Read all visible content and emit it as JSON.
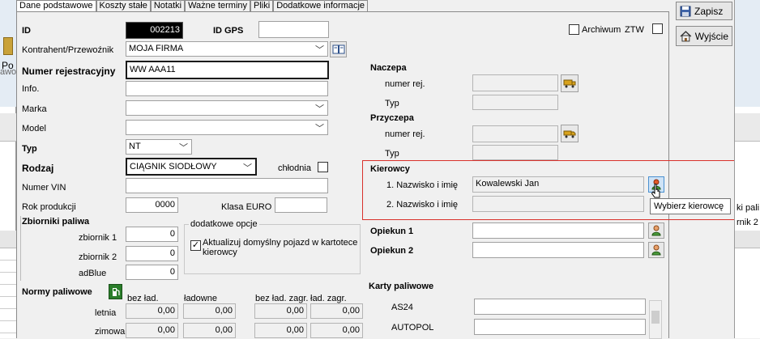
{
  "tabs": [
    "Dane podstawowe",
    "Koszty stałe",
    "Notatki",
    "Ważne terminy",
    "Pliki",
    "Dodatkowe informacje"
  ],
  "left_fragments": {
    "po": "Po",
    "awo": "awo"
  },
  "fields": {
    "id_label": "ID",
    "id_value": "002213",
    "idgps_label": "ID GPS",
    "archiwum_label": "Archiwum",
    "ztw_label": "ZTW",
    "kontrahent_label": "Kontrahent/Przewoźnik",
    "kontrahent_value": "MOJA FIRMA",
    "numer_label": "Numer rejestracyjny",
    "numer_value": "WW AAA11",
    "info_label": "Info.",
    "marka_label": "Marka",
    "model_label": "Model",
    "typ_label": "Typ",
    "typ_value": "NT",
    "rodzaj_label": "Rodzaj",
    "rodzaj_value": "CIĄGNIK SIODŁOWY",
    "chlodnia_label": "chłodnia",
    "vin_label": "Numer VIN",
    "rok_label": "Rok produkcji",
    "rok_value": "0000",
    "euro_label": "Klasa EURO"
  },
  "tanks": {
    "title": "Zbiorniki paliwa",
    "z1_label": "zbiornik 1",
    "z1_value": "0",
    "z2_label": "zbiornik 2",
    "z2_value": "0",
    "adblue_label": "adBlue",
    "adblue_value": "0"
  },
  "options": {
    "title": "dodatkowe opcje",
    "aktualizuj_line1": "Aktualizuj domyślny pojazd w kartotece",
    "aktualizuj_line2": "kierowcy"
  },
  "norms": {
    "title": "Normy paliwowe",
    "headers": [
      "bez ład.",
      "ładowne",
      "bez ład. zagr.",
      "ład. zagr."
    ],
    "rows": [
      {
        "label": "letnia",
        "values": [
          "0,00",
          "0,00",
          "0,00",
          "0,00"
        ]
      },
      {
        "label": "zimowa",
        "values": [
          "0,00",
          "0,00",
          "0,00",
          "0,00"
        ]
      }
    ]
  },
  "naczepa": {
    "title": "Naczepa",
    "numer_label": "numer rej.",
    "typ_label": "Typ"
  },
  "przyczepa": {
    "title": "Przyczepa",
    "numer_label": "numer rej.",
    "typ_label": "Typ"
  },
  "kierowcy": {
    "title": "Kierowcy",
    "k1_label": "1. Nazwisko i imię",
    "k1_value": "Kowalewski Jan",
    "k2_label": "2. Nazwisko i imię",
    "tooltip": "Wybierz kierowcę"
  },
  "opiekun": {
    "o1_label": "Opiekun 1",
    "o2_label": "Opiekun 2"
  },
  "karty": {
    "title": "Karty paliwowe",
    "as24": "AS24",
    "autopol": "AUTOPOL"
  },
  "buttons": {
    "zapisz": "Zapisz",
    "wyjscie": "Wyjście"
  },
  "right_fragments": {
    "row1": "ki pali",
    "row2": "rnik 2"
  },
  "colors": {
    "kierowcy_box": "#d9312b",
    "id_field_bg": "#000000"
  }
}
